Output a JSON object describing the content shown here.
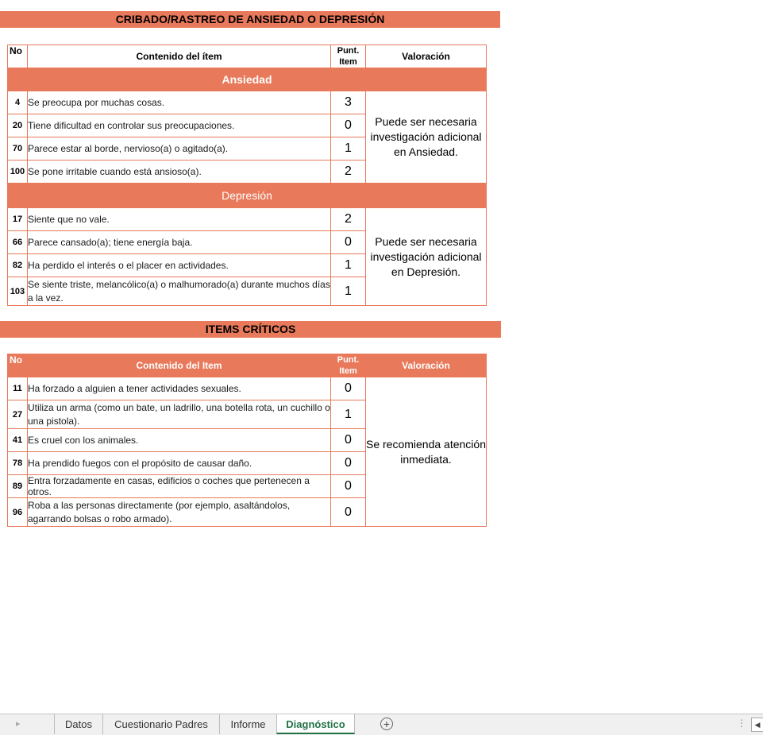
{
  "screening": {
    "title": "CRIBADO/RASTREO DE ANSIEDAD O DEPRESIÓN",
    "headers": {
      "no": "No",
      "content": "Contenido del ítem",
      "score": "Punt. Item",
      "rating": "Valoración"
    },
    "sections": [
      {
        "name": "Ansiedad",
        "rating": "Puede ser necesaria investigación adicional en Ansiedad.",
        "items": [
          {
            "no": "4",
            "text": "Se preocupa por muchas cosas.",
            "score": "3"
          },
          {
            "no": "20",
            "text": "Tiene dificultad en controlar sus preocupaciones.",
            "score": "0"
          },
          {
            "no": "70",
            "text": "Parece estar al borde, nervioso(a) o agitado(a).",
            "score": "1"
          },
          {
            "no": "100",
            "text": "Se pone irritable cuando está ansioso(a).",
            "score": "2"
          }
        ]
      },
      {
        "name": "Depresión",
        "rating": "Puede ser necesaria investigación adicional en Depresión.",
        "items": [
          {
            "no": "17",
            "text": "Siente que no vale.",
            "score": "2"
          },
          {
            "no": "66",
            "text": "Parece cansado(a); tiene energía baja.",
            "score": "0"
          },
          {
            "no": "82",
            "text": "Ha perdido el interés o el placer en actividades.",
            "score": "1"
          },
          {
            "no": "103",
            "text": "Se siente triste, melancólico(a) o malhumorado(a) durante muchos días a la vez.",
            "score": "1"
          }
        ]
      }
    ]
  },
  "critical": {
    "title": "ITEMS CRÍTICOS",
    "headers": {
      "no": "No",
      "content": "Contenido del Item",
      "score": "Punt. Item",
      "rating": "Valoración"
    },
    "rating": "Se recomienda atención inmediata.",
    "items": [
      {
        "no": "11",
        "text": "Ha forzado a alguien a tener actividades sexuales.",
        "score": "0"
      },
      {
        "no": "27",
        "text": "Utiliza un arma (como un bate, un ladrillo, una botella rota, un cuchillo o una pistola).",
        "score": "1"
      },
      {
        "no": "41",
        "text": "Es cruel con los animales.",
        "score": "0"
      },
      {
        "no": "78",
        "text": "Ha prendido fuegos con el propósito de causar daño.",
        "score": "0"
      },
      {
        "no": "89",
        "text": "Entra forzadamente en casas, edificios o coches que pertenecen a otros.",
        "score": "0"
      },
      {
        "no": "96",
        "text": "Roba a las personas directamente (por ejemplo, asaltándolos, agarrando bolsas o robo armado).",
        "score": "0"
      }
    ]
  },
  "tabs": {
    "sheets": [
      "Datos",
      "Cuestionario Padres",
      "Informe",
      "Diagnóstico"
    ],
    "active": "Diagnóstico",
    "add_icon": "plus-circle-icon"
  },
  "colors": {
    "accent": "#e8795b",
    "active_tab": "#217346"
  }
}
